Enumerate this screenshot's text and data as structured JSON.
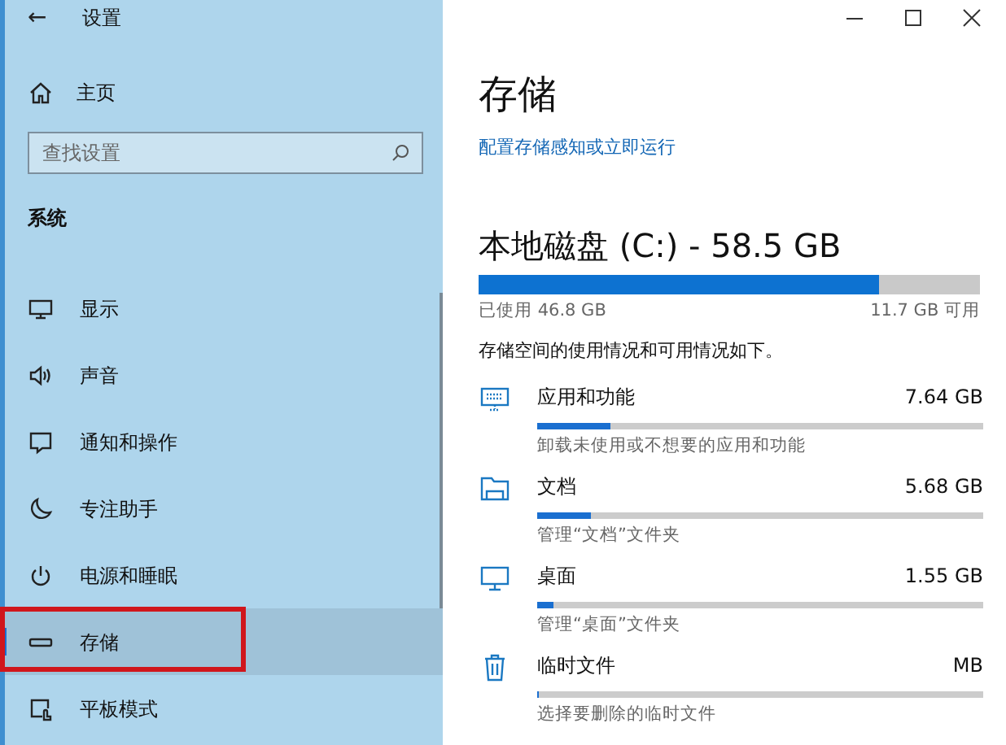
{
  "window": {
    "title": "设置",
    "back": "←"
  },
  "sidebar": {
    "home": "主页",
    "search": {
      "placeholder": "查找设置"
    },
    "section": "系统",
    "items": [
      {
        "label": "显示",
        "kind": "display",
        "selected": false,
        "highlighted": false
      },
      {
        "label": "声音",
        "kind": "sound",
        "selected": false,
        "highlighted": false
      },
      {
        "label": "通知和操作",
        "kind": "notification",
        "selected": false,
        "highlighted": false
      },
      {
        "label": "专注助手",
        "kind": "moon",
        "selected": false,
        "highlighted": false
      },
      {
        "label": "电源和睡眠",
        "kind": "power",
        "selected": false,
        "highlighted": false
      },
      {
        "label": "存储",
        "kind": "storage",
        "selected": true,
        "highlighted": true
      },
      {
        "label": "平板模式",
        "kind": "tablet",
        "selected": false,
        "highlighted": false
      }
    ]
  },
  "main": {
    "title": "存储",
    "link": "配置存储感知或立即运行",
    "drive": {
      "title": "本地磁盘 (C:) - 58.5 GB",
      "level": 0.8,
      "used": "已使用 46.8 GB",
      "free": "11.7 GB 可用"
    },
    "description": "存储空间的使用情况和可用情况如下。",
    "categories": [
      {
        "kind": "apps",
        "name": "应用和功能",
        "size": "7.64 GB",
        "level": 0.165,
        "hint": "卸载未使用或不想要的应用和功能"
      },
      {
        "kind": "documents",
        "name": "文档",
        "size": "5.68 GB",
        "level": 0.12,
        "hint": "管理“文档”文件夹"
      },
      {
        "kind": "desktop",
        "name": "桌面",
        "size": "1.55 GB",
        "level": 0.035,
        "hint": "管理“桌面”文件夹"
      },
      {
        "kind": "temp",
        "name": "临时文件",
        "size": "MB",
        "level": 0.005,
        "hint": "选择要删除的临时文件"
      }
    ]
  }
}
